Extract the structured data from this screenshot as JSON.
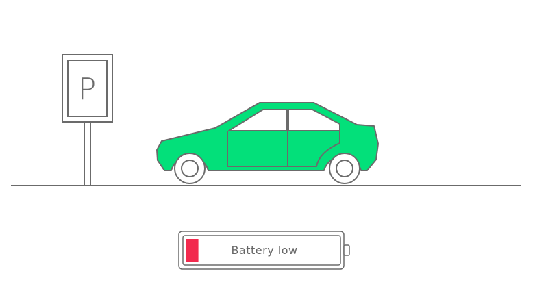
{
  "scene": {
    "parking_sign_letter": "P",
    "battery": {
      "label": "Battery low",
      "charge_fraction": 0.08
    }
  },
  "colors": {
    "car_body": "#03e07a",
    "outline": "#6b6b6b",
    "battery_level": "#f22a4e",
    "background": "#ffffff"
  },
  "icons": {
    "parking_sign": "parking-sign-icon",
    "car": "car-icon",
    "battery": "battery-icon"
  }
}
